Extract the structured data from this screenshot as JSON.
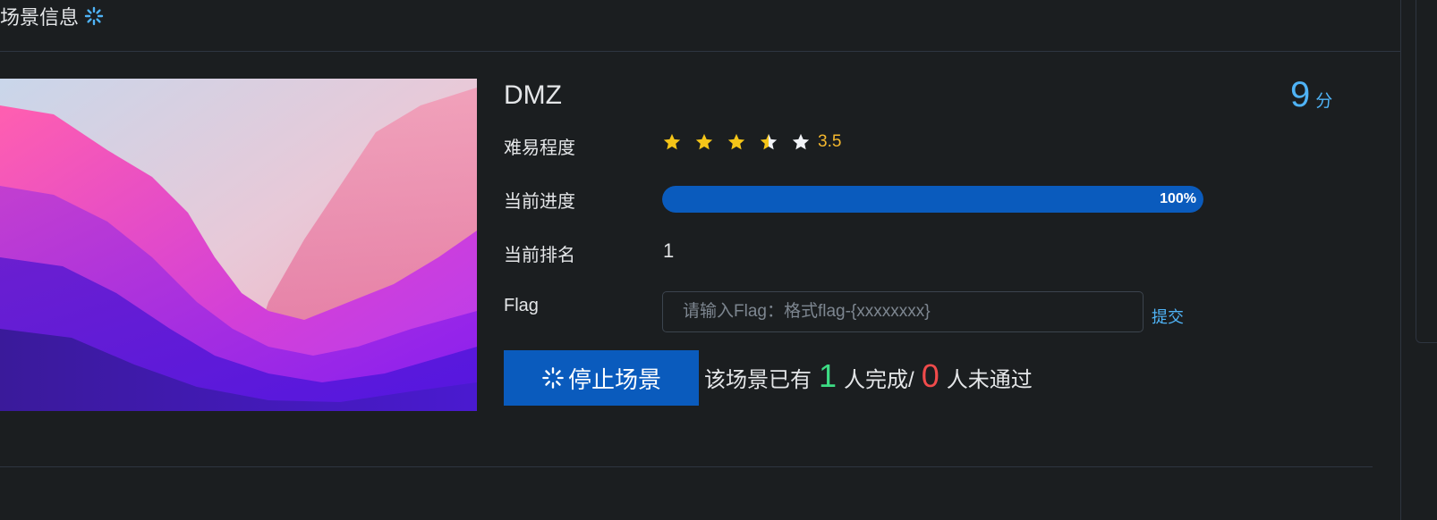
{
  "header": {
    "title": "场景信息",
    "title_icon": "spinner-icon"
  },
  "scene": {
    "name": "DMZ",
    "score_value": "9",
    "score_unit": "分",
    "difficulty_label": "难易程度",
    "difficulty_value": "3.5",
    "difficulty_stars_total": 5,
    "progress_label": "当前进度",
    "progress_value": 1.0,
    "progress_text": "100%",
    "rank_label": "当前排名",
    "rank_value": "1",
    "flag_label": "Flag",
    "flag_placeholder": "请输入Flag：格式flag-{xxxxxxxx}",
    "submit_label": "提交"
  },
  "actions": {
    "stop_label": "停止场景",
    "stop_icon": "spinner-icon"
  },
  "stats": {
    "prefix": "该场景已有",
    "completed_count": "1",
    "completed_suffix": "人完成/",
    "failed_count": "0",
    "failed_suffix": "人未通过"
  },
  "colors": {
    "background": "#1b1e20",
    "accent_blue": "#0a5bbd",
    "score_blue": "#4fb3f6",
    "star_gold": "#f5b82e",
    "success_green": "#3ddc84",
    "fail_red": "#f04b4b"
  }
}
